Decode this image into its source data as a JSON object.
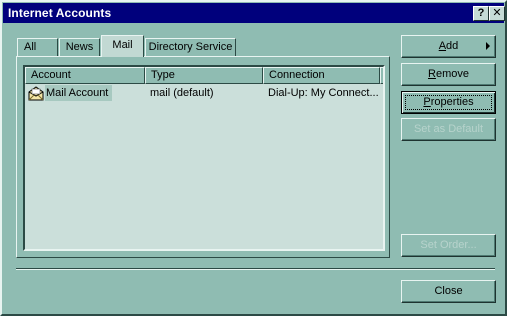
{
  "window": {
    "title": "Internet Accounts",
    "help_glyph": "?",
    "close_glyph": "✕"
  },
  "tabs": [
    {
      "label": "All",
      "active": false
    },
    {
      "label": "News",
      "active": false
    },
    {
      "label": "Mail",
      "active": true
    },
    {
      "label": "Directory Service",
      "active": false
    }
  ],
  "list": {
    "columns": [
      "Account",
      "Type",
      "Connection"
    ],
    "rows": [
      {
        "account": "Mail Account",
        "type": "mail (default)",
        "connection": "Dial-Up: My Connect...",
        "icon": "mail-account-icon",
        "selected": true
      }
    ]
  },
  "buttons": {
    "add": {
      "label_first": "A",
      "label_rest": "dd",
      "enabled": true
    },
    "remove": {
      "label_first": "R",
      "label_rest": "emove",
      "enabled": true
    },
    "properties": {
      "label_first": "P",
      "label_rest": "roperties",
      "enabled": true
    },
    "set_default": {
      "label": "Set as Default",
      "enabled": false
    },
    "set_order": {
      "label": "Set Order...",
      "enabled": false
    },
    "close": {
      "label": "Close",
      "enabled": true
    }
  },
  "colors": {
    "titlebar": "#00007c",
    "face": "#8fbcb2",
    "list_background": "#cbdfda"
  }
}
